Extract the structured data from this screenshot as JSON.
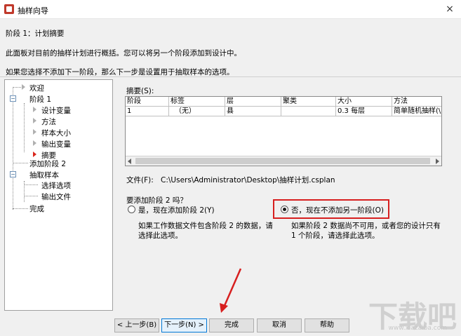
{
  "window": {
    "title": "抽样向导",
    "close_label": "×"
  },
  "header": {
    "stage_title": "阶段 1：计划摘要",
    "description": "此面板对目前的抽样计划进行概括。您可以将另一个阶段添加到设计中。",
    "description2": "如果您选择不添加下一阶段，那么下一步是设置用于抽取样本的选项。"
  },
  "nav": {
    "items": [
      {
        "label": "欢迎"
      },
      {
        "label": "阶段 1"
      },
      {
        "label": "设计变量"
      },
      {
        "label": "方法"
      },
      {
        "label": "样本大小"
      },
      {
        "label": "输出变量"
      },
      {
        "label": "摘要"
      },
      {
        "label": "添加阶段 2"
      },
      {
        "label": "抽取样本"
      },
      {
        "label": "选择选项"
      },
      {
        "label": "输出文件"
      },
      {
        "label": "完成"
      }
    ]
  },
  "summary": {
    "label": "摘要(S):",
    "columns": [
      "阶段",
      "标签",
      "层",
      "聚类",
      "大小",
      "方法"
    ],
    "rows": [
      [
        "1",
        "（无）",
        "县",
        "",
        "0.3 每层",
        "简单随机抽样(\\"
      ]
    ]
  },
  "file": {
    "label": "文件(F):",
    "path": "C:\\Users\\Administrator\\Desktop\\抽样计划.csplan"
  },
  "question": {
    "label": "要添加阶段 2 吗？",
    "option_yes": "是，现在添加阶段 2(Y)",
    "option_yes_desc_1": "如果工作数据文件包含阶段 2 的数据，请",
    "option_yes_desc_2": "选择此选项。",
    "option_no": "否，现在不添加另一阶段(O)",
    "option_no_desc_1": "如果阶段 2 数据尚不可用，或者您的设计只有",
    "option_no_desc_2": "1 个阶段，请选择此选项。",
    "selected": "no"
  },
  "buttons": {
    "back": "< 上一步(B)",
    "next": "下一步(N) >",
    "finish": "完成",
    "cancel": "取消",
    "help": "帮助"
  },
  "watermark": {
    "text": "下载吧",
    "sub": "www.xiazaiba.com"
  },
  "colors": {
    "highlight": "#d71f1f",
    "active_arrow": "#d9261c"
  }
}
